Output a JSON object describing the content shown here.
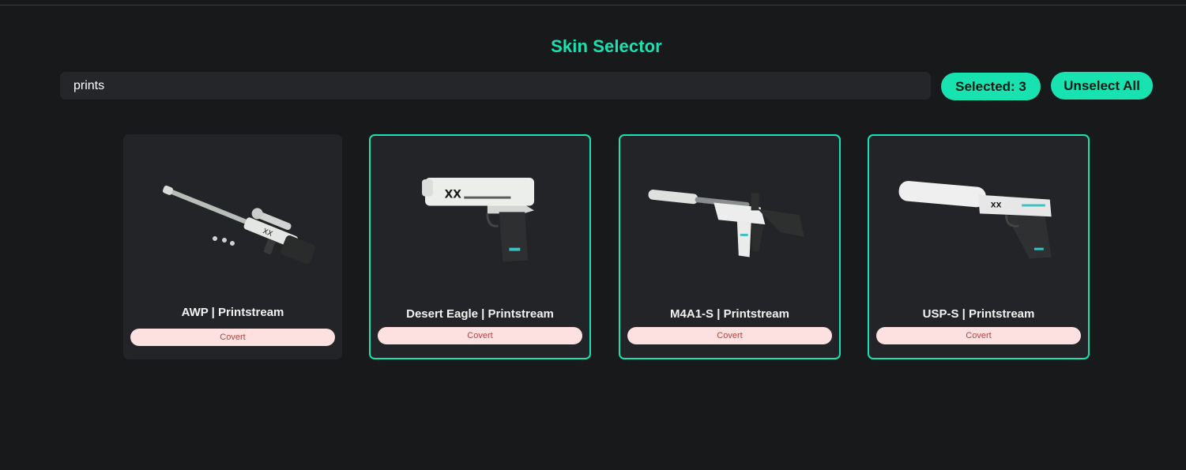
{
  "page": {
    "title": "Skin Selector"
  },
  "search": {
    "value": "prints",
    "placeholder": ""
  },
  "toolbar": {
    "selected_label": "Selected: 3",
    "unselect_all_label": "Unselect All"
  },
  "cards": [
    {
      "name": "AWP | Printstream",
      "rarity": "Covert",
      "selected": false,
      "weapon_icon": "awp-rifle-icon"
    },
    {
      "name": "Desert Eagle | Printstream",
      "rarity": "Covert",
      "selected": true,
      "weapon_icon": "desert-eagle-pistol-icon"
    },
    {
      "name": "M4A1-S | Printstream",
      "rarity": "Covert",
      "selected": true,
      "weapon_icon": "m4a1s-rifle-icon"
    },
    {
      "name": "USP-S | Printstream",
      "rarity": "Covert",
      "selected": true,
      "weapon_icon": "usps-pistol-icon"
    }
  ],
  "colors": {
    "accent": "#18e3b0",
    "background": "#18191b",
    "card": "#232427",
    "rarity_bg": "#fde0e0",
    "rarity_text": "#b34545"
  }
}
